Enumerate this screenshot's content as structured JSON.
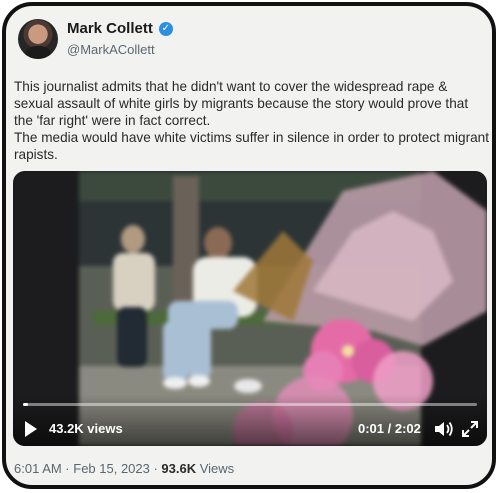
{
  "author": {
    "name": "Mark Collett",
    "handle": "@MarkACollett",
    "verified_icon": "verified-badge-icon",
    "verified_color": "#2d8fe0"
  },
  "tweet": {
    "text_line1": "This journalist admits that he didn't want to cover the widespread rape & sexual assault of white girls by migrants because the story would prove that the 'far right' were in fact correct.",
    "text_line2": "The media would have white victims suffer in silence in order to protect migrant rapists."
  },
  "video": {
    "views": "43.2K views",
    "time": "0:01 / 2:02",
    "progress_fraction": 0.008,
    "icons": [
      "play-icon",
      "speaker-icon",
      "expand-icon"
    ]
  },
  "meta": {
    "timestamp": "6:01 AM · Feb 15, 2023 · ",
    "view_count": "93.6K",
    "views_label": " Views"
  }
}
